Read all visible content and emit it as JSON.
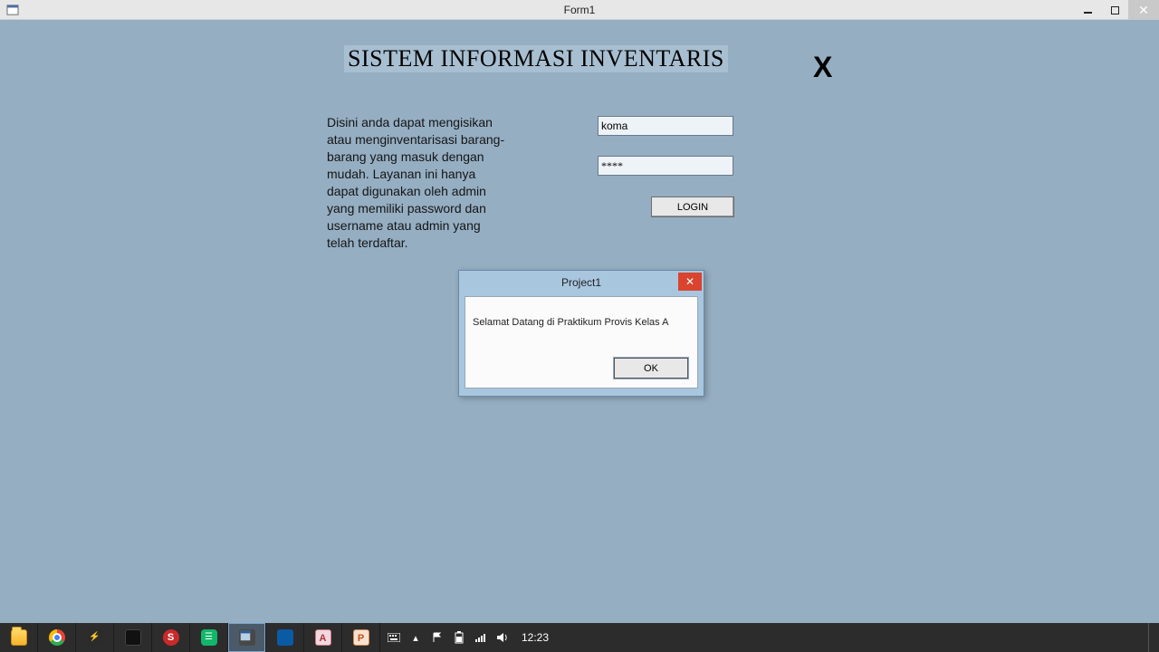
{
  "window": {
    "title": "Form1"
  },
  "form": {
    "headline": "SISTEM INFORMASI INVENTARIS",
    "close_label": "X",
    "description": "Disini anda dapat mengisikan atau menginventarisasi barang-barang yang masuk dengan mudah. Layanan ini hanya dapat digunakan oleh admin yang memiliki password dan username atau admin yang telah terdaftar.",
    "username_value": "koma",
    "password_value_masked": "****",
    "login_label": "LOGIN"
  },
  "msgbox": {
    "title": "Project1",
    "message": "Selamat Datang di Praktikum Provis Kelas A",
    "ok_label": "OK"
  },
  "tray": {
    "clock": "12:23"
  }
}
